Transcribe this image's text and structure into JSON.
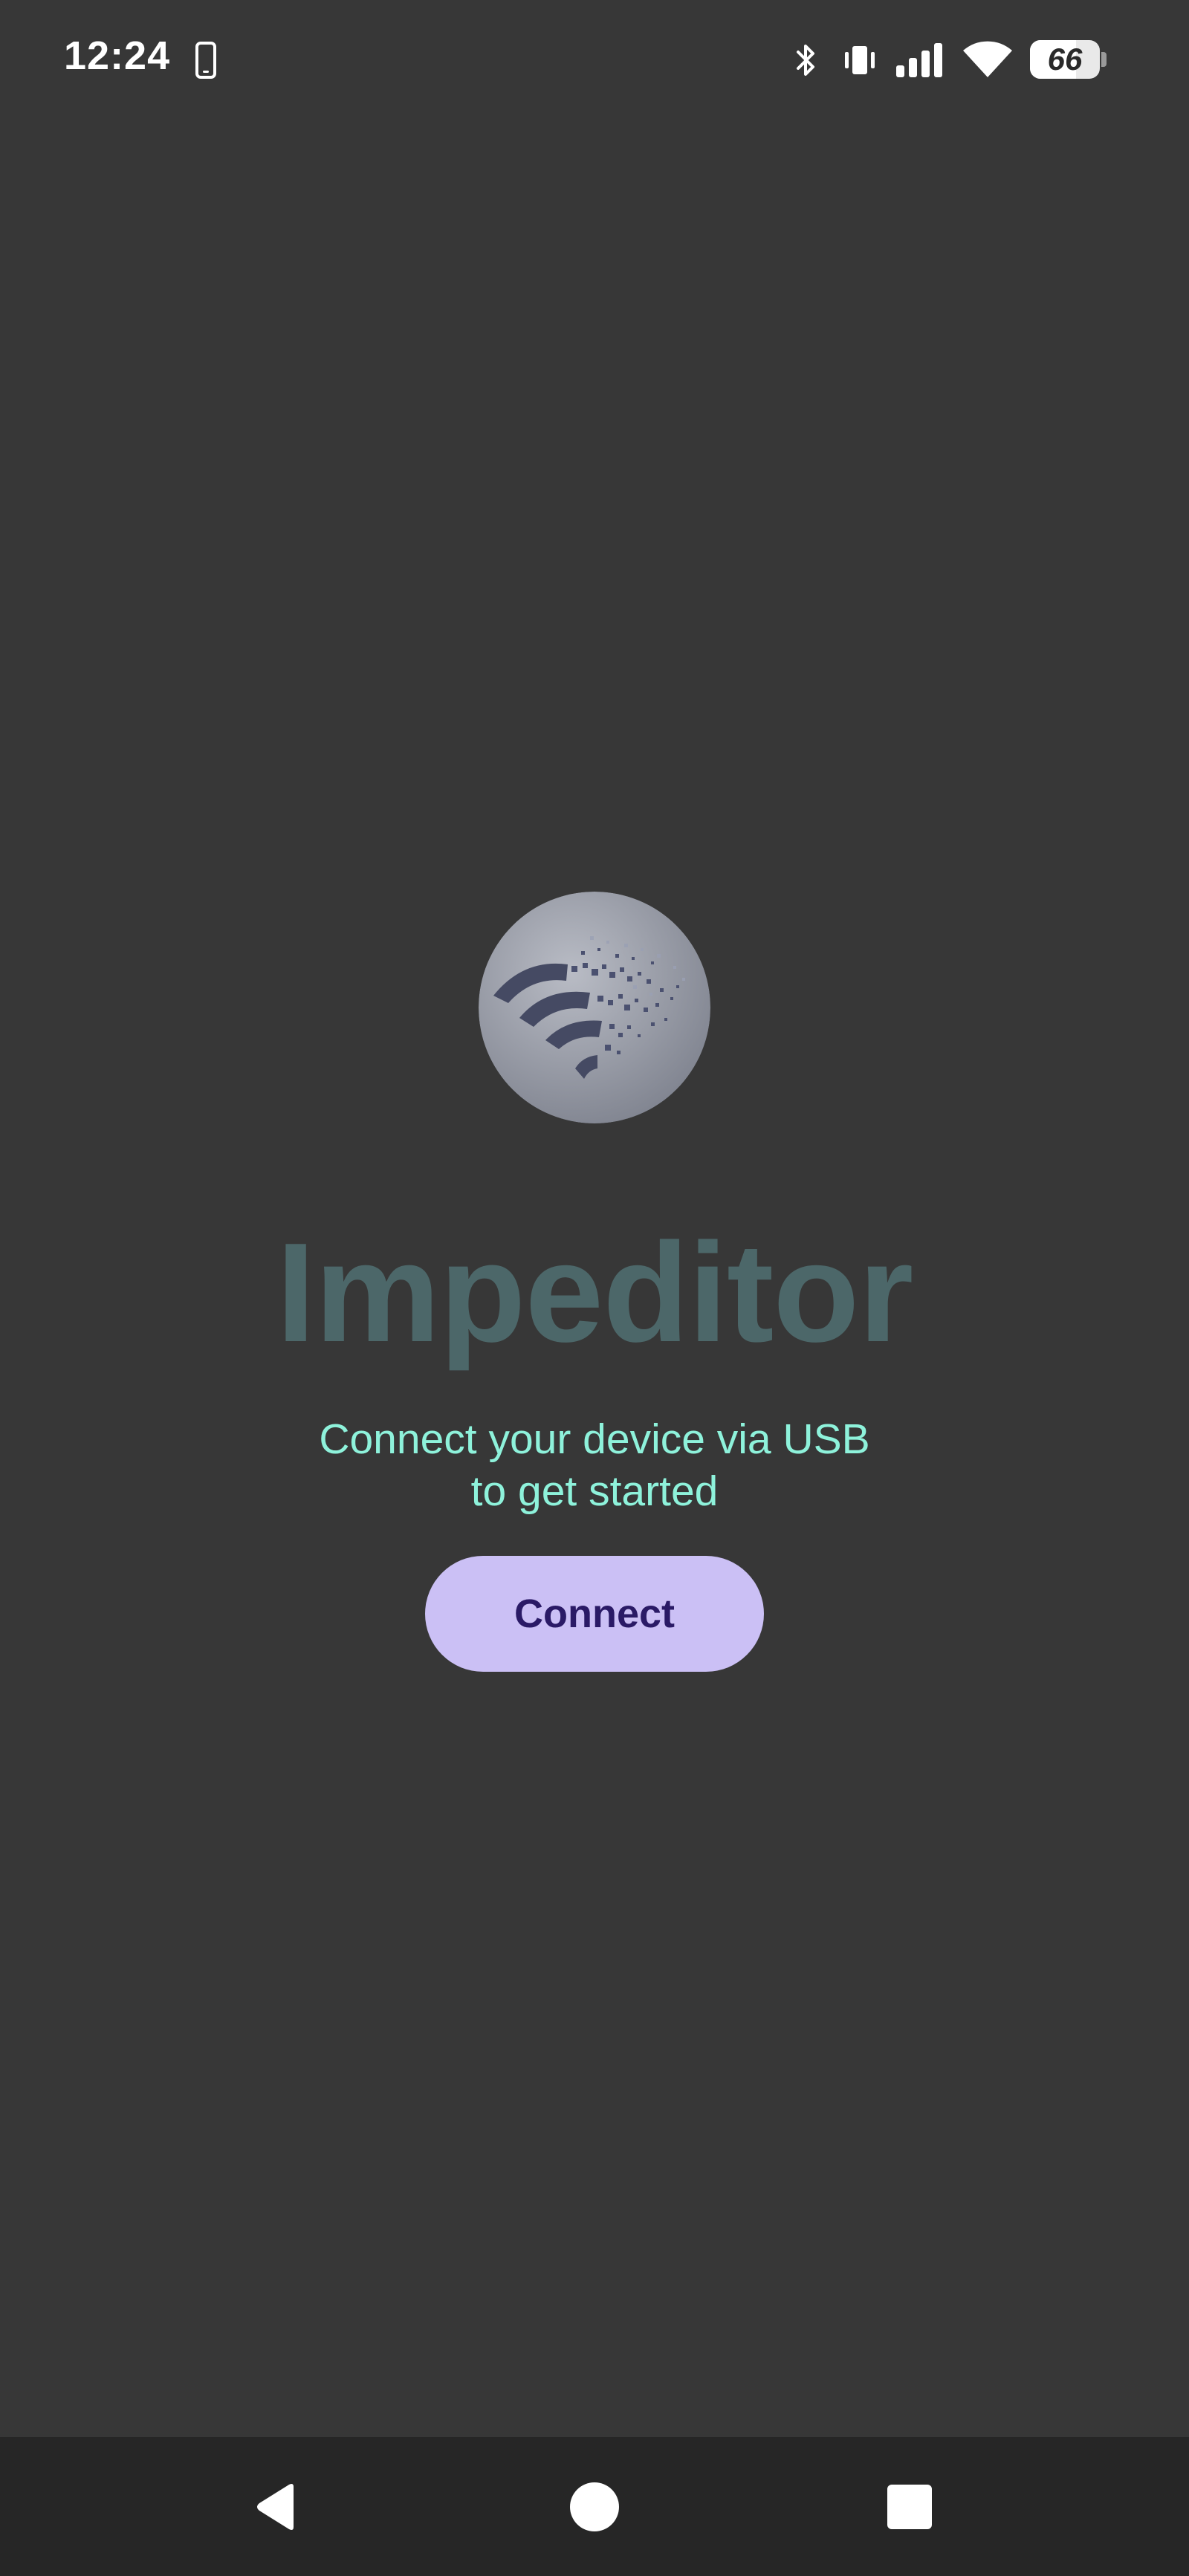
{
  "status_bar": {
    "time": "12:24",
    "battery_level": "66",
    "battery_fraction": 0.66,
    "icons": [
      "phone-icon",
      "bluetooth-icon",
      "vibrate-icon",
      "cellular-signal-icon",
      "wifi-icon",
      "battery-icon"
    ]
  },
  "app": {
    "title": "Impeditor",
    "subtitle_line1": "Connect your device via USB",
    "subtitle_line2": "to get started",
    "connect_label": "Connect",
    "logo_icon": "wifi-disintegrating-logo-icon"
  },
  "colors": {
    "background": "#373737",
    "title": "#4c6769",
    "subtitle": "#8ef2db",
    "button_bg": "#cbc0f5",
    "button_text": "#2a1a66",
    "nav_bar": "#262626"
  },
  "nav_bar": {
    "icons": [
      "back-icon",
      "home-icon",
      "recents-icon"
    ]
  }
}
